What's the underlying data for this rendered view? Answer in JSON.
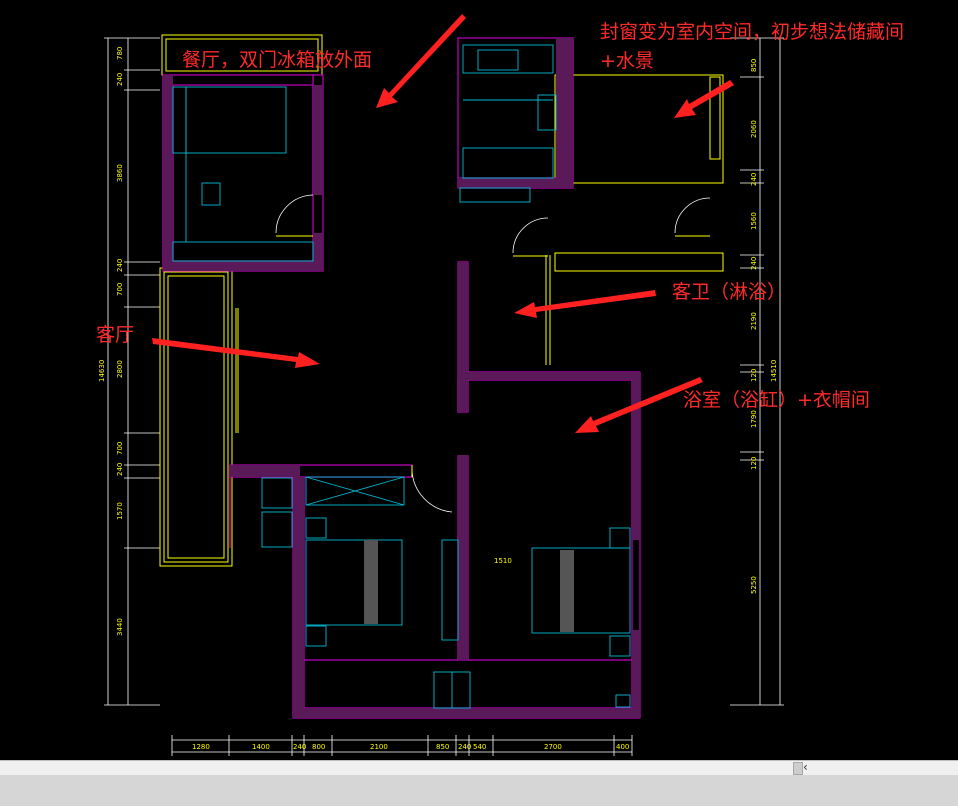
{
  "annotations": {
    "dining": "餐厅，双门冰箱放外面",
    "enclosed": "封窗变为室内空间，初步想法储藏间",
    "enclosed_line2": "+水景",
    "guest_bath": "客卫（淋浴）",
    "living": "客厅",
    "master_bath": "浴室（浴缸）+衣帽间"
  },
  "dimensions": {
    "bottom": [
      "1280",
      "1400",
      "240",
      "800",
      "2100",
      "850",
      "240",
      "540",
      "2700",
      "400"
    ],
    "left": [
      "780",
      "240",
      "3860",
      "240",
      "700",
      "2800",
      "700",
      "240",
      "1570",
      "3440"
    ],
    "left_total": "14630",
    "right": [
      "850",
      "2060",
      "240",
      "1560",
      "240",
      "2190",
      "120",
      "1790",
      "120",
      "5250"
    ],
    "right_total": "14510",
    "interior": "1510"
  },
  "colors": {
    "background": "#000000",
    "wall": "#c000c0",
    "window": "#ffff00",
    "furniture": "#00bcd4",
    "annotation": "#ff2a2a",
    "arrow": "#ff2020"
  }
}
